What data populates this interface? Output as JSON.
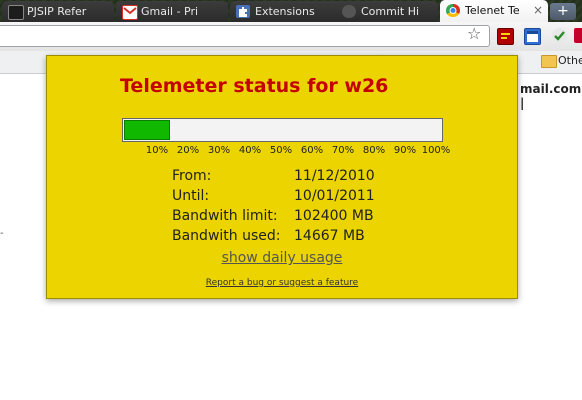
{
  "tabs": [
    {
      "label": "PJSIP Refer",
      "icon": "pjsip-icon",
      "icon_color": "#1c1c1c"
    },
    {
      "label": "Gmail - Pri",
      "icon": "gmail-icon",
      "icon_color": "#d93025"
    },
    {
      "label": "Extensions",
      "icon": "puzzle-icon",
      "icon_color": "#4a6fb5"
    },
    {
      "label": "Commit Hi",
      "icon": "github-icon",
      "icon_color": "#333333"
    },
    {
      "label": "Telenet Te",
      "icon": "chrome-icon",
      "icon_color": "#3b82f6"
    }
  ],
  "new_tab_label": "+",
  "bookmarks": {
    "folder_label": "Othe"
  },
  "page": {
    "visible_text": "mail.com |"
  },
  "popup": {
    "title": "Telemeter status for w26",
    "usage_fraction": 0.143,
    "ticks": [
      "10%",
      "20%",
      "30%",
      "40%",
      "50%",
      "60%",
      "70%",
      "80%",
      "90%",
      "100%"
    ],
    "rows": [
      {
        "label": "From:",
        "value": "11/12/2010"
      },
      {
        "label": "Until:",
        "value": "10/01/2011"
      },
      {
        "label": "Bandwith limit:",
        "value": "102400 MB"
      },
      {
        "label": "Bandwith used:",
        "value": "14667 MB"
      }
    ],
    "daily_link": "show daily usage",
    "bug_link": "Report a bug or suggest a feature"
  },
  "colors": {
    "popup_bg": "#ebd400",
    "title": "#c40000",
    "progress_fill": "#11b800"
  }
}
